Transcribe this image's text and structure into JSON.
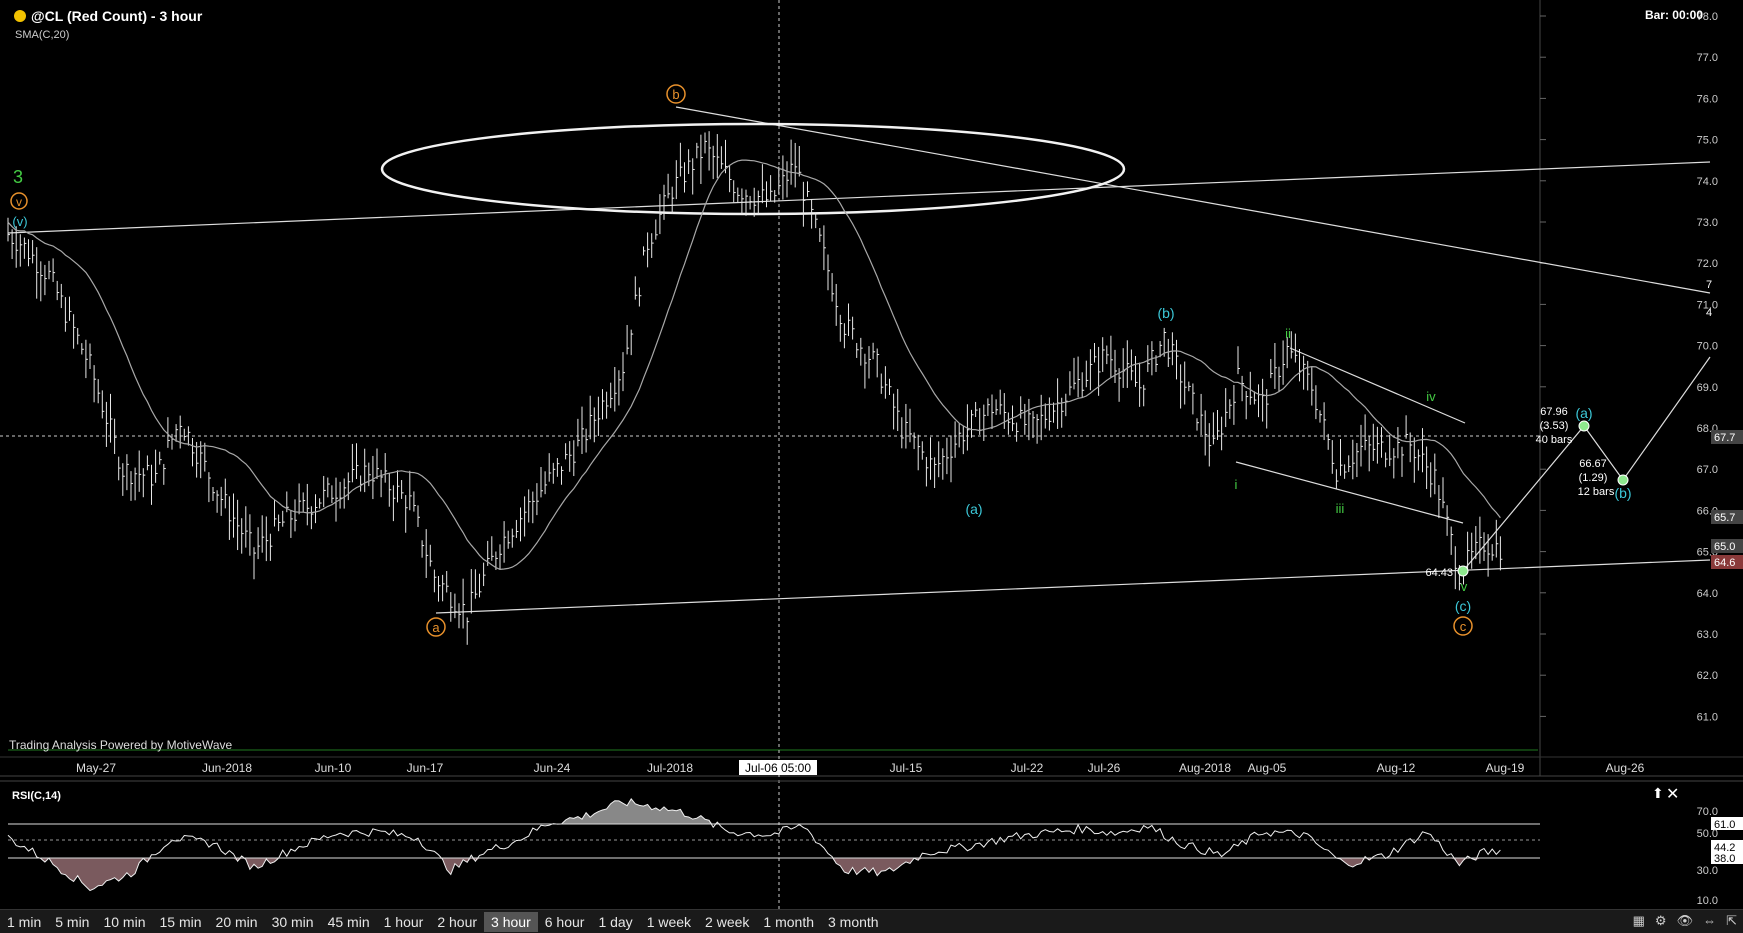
{
  "header": {
    "symbol_title": "@CL (Red Count) - 3 hour",
    "indicator_label": "SMA(C,20)",
    "bar_timer": "Bar: 00:00",
    "powered_by": "Trading Analysis Powered by MotiveWave"
  },
  "colors": {
    "background": "#000000",
    "price_bars": "#e8e8e8",
    "sma": "#aaaaaa",
    "wave_orange": "#e8912c",
    "wave_cyan": "#3cc8d8",
    "wave_green": "#44cc44",
    "rsi_fill": "#7a5a5e",
    "rsi_fill_top": "#888888"
  },
  "price_axis": {
    "labels": [
      "78.0",
      "77.0",
      "76.0",
      "75.0",
      "74.0",
      "73.0",
      "72.0",
      "71.0",
      "70.0",
      "69.0",
      "68.0",
      "67.0",
      "66.0",
      "65.0",
      "64.0",
      "63.0",
      "62.0",
      "61.0"
    ],
    "tags": [
      {
        "text": "67.7",
        "color": "#444444"
      },
      {
        "text": "65.7",
        "color": "#444444"
      },
      {
        "text": "65.0",
        "color": "#444444"
      },
      {
        "text": "64.6",
        "color": "#8a3a3a"
      }
    ],
    "side_labels": [
      "7",
      "4"
    ]
  },
  "time_axis": {
    "labels": [
      "May-27",
      "Jun-2018",
      "Jun-10",
      "Jun-17",
      "Jun-24",
      "Jul-2018",
      "Jul-15",
      "Jul-22",
      "Jul-26",
      "Aug-2018",
      "Aug-05",
      "Aug-12",
      "Aug-19",
      "Aug-26"
    ],
    "crosshair_label": "Jul-06 05:00"
  },
  "wave_labels": {
    "minor_3": "3",
    "v_orange": "v",
    "v_cyan": "(v)",
    "b_orange": "b",
    "a_orange": "a",
    "c_orange": "c",
    "a_cyan": "(a)",
    "b_cyan": "(b)",
    "c_cyan": "(c)",
    "i": "i",
    "ii": "ii",
    "iii": "iii",
    "iv": "iv",
    "v_green": "v",
    "proj_a": "(a)",
    "proj_b": "(b)"
  },
  "projections": {
    "low_price": "64.43",
    "a_price": "67.96",
    "a_change": "(3.53)",
    "a_bars": "40 bars",
    "b_price": "66.67",
    "b_change": "(1.29)",
    "b_bars": "12 bars"
  },
  "rsi": {
    "title": "RSI(C,14)",
    "axis_labels": [
      "70.0",
      "61.0",
      "50.0",
      "44.2",
      "38.0",
      "30.0",
      "10.0"
    ],
    "current": 44.2,
    "upper_band": 61.0,
    "lower_band": 38.0
  },
  "timeframes": [
    "1 min",
    "5 min",
    "10 min",
    "15 min",
    "20 min",
    "30 min",
    "45 min",
    "1 hour",
    "2 hour",
    "3 hour",
    "6 hour",
    "1 day",
    "1 week",
    "2 week",
    "1 month",
    "3 month"
  ],
  "active_timeframe": "3 hour",
  "chart_data": {
    "type": "line",
    "title": "@CL (Red Count) - 3 hour",
    "ylim": [
      60.5,
      78.3
    ],
    "x": [
      "May-27",
      "Jun-2018",
      "Jun-10",
      "Jun-17",
      "Jun-24",
      "Jul-2018",
      "Jul-15",
      "Jul-22",
      "Jul-26",
      "Aug-2018",
      "Aug-05",
      "Aug-12",
      "Aug-19"
    ],
    "series": [
      {
        "name": "SMA(C,20)",
        "values": [
          68.0,
          65.8,
          66.2,
          66.4,
          66.5,
          73.2,
          70.0,
          67.3,
          69.0,
          69.0,
          69.2,
          66.8,
          65.0
        ]
      }
    ],
    "price_path": [
      [
        0,
        72.7
      ],
      [
        3,
        72.5
      ],
      [
        10,
        71.7
      ],
      [
        20,
        69.5
      ],
      [
        28,
        67.0
      ],
      [
        36,
        66.8
      ],
      [
        42,
        68.2
      ],
      [
        52,
        66.3
      ],
      [
        60,
        65.0
      ],
      [
        68,
        65.8
      ],
      [
        78,
        66.4
      ],
      [
        88,
        67.0
      ],
      [
        98,
        66.2
      ],
      [
        104,
        64.4
      ],
      [
        112,
        63.5
      ],
      [
        120,
        65.2
      ],
      [
        130,
        66.5
      ],
      [
        140,
        67.7
      ],
      [
        150,
        69.5
      ],
      [
        156,
        72.5
      ],
      [
        162,
        73.8
      ],
      [
        170,
        74.8
      ],
      [
        178,
        73.8
      ],
      [
        186,
        73.5
      ],
      [
        192,
        74.4
      ],
      [
        198,
        72.5
      ],
      [
        204,
        70.5
      ],
      [
        212,
        69.5
      ],
      [
        218,
        68.0
      ],
      [
        226,
        67.0
      ],
      [
        232,
        67.8
      ],
      [
        240,
        68.5
      ],
      [
        250,
        68.0
      ],
      [
        260,
        69.0
      ],
      [
        268,
        69.8
      ],
      [
        276,
        69.0
      ],
      [
        282,
        70.2
      ],
      [
        288,
        68.8
      ],
      [
        294,
        67.5
      ],
      [
        300,
        69.2
      ],
      [
        306,
        68.6
      ],
      [
        312,
        69.9
      ],
      [
        318,
        69.0
      ],
      [
        324,
        67.0
      ],
      [
        330,
        67.5
      ],
      [
        336,
        67.5
      ],
      [
        342,
        67.6
      ],
      [
        348,
        66.8
      ],
      [
        354,
        64.5
      ],
      [
        360,
        65.2
      ],
      [
        364,
        65.1
      ]
    ],
    "rsi_path": [
      [
        0,
        52
      ],
      [
        10,
        36
      ],
      [
        20,
        18
      ],
      [
        30,
        28
      ],
      [
        40,
        52
      ],
      [
        50,
        48
      ],
      [
        60,
        32
      ],
      [
        70,
        45
      ],
      [
        80,
        55
      ],
      [
        90,
        56
      ],
      [
        100,
        52
      ],
      [
        108,
        30
      ],
      [
        116,
        42
      ],
      [
        124,
        50
      ],
      [
        132,
        62
      ],
      [
        140,
        66
      ],
      [
        150,
        76
      ],
      [
        158,
        73
      ],
      [
        166,
        68
      ],
      [
        176,
        56
      ],
      [
        186,
        54
      ],
      [
        194,
        60
      ],
      [
        204,
        30
      ],
      [
        214,
        28
      ],
      [
        224,
        42
      ],
      [
        234,
        46
      ],
      [
        244,
        52
      ],
      [
        252,
        55
      ],
      [
        262,
        58
      ],
      [
        270,
        55
      ],
      [
        278,
        60
      ],
      [
        286,
        48
      ],
      [
        296,
        40
      ],
      [
        306,
        56
      ],
      [
        316,
        54
      ],
      [
        326,
        34
      ],
      [
        336,
        40
      ],
      [
        346,
        56
      ],
      [
        354,
        34
      ],
      [
        360,
        42
      ],
      [
        364,
        43
      ]
    ]
  }
}
